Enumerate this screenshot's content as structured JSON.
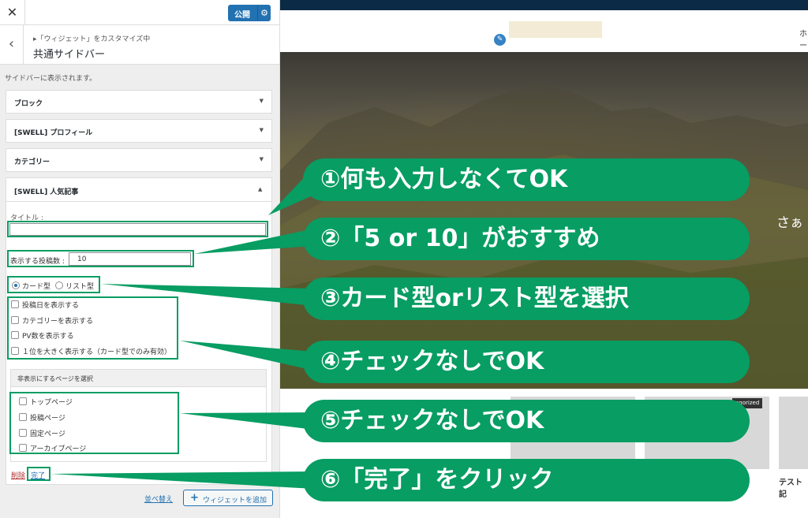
{
  "topbar": {
    "close": "✕",
    "publish_label": "公開",
    "gear_icon": "⚙"
  },
  "section": {
    "back": "‹",
    "breadcrumb": "▸「ウィジェット」をカスタマイズ中",
    "title": "共通サイドバー",
    "description": "サイドバーに表示されます。"
  },
  "widgets": [
    {
      "title": "ブロック",
      "arrow": "▼"
    },
    {
      "title": "[SWELL] プロフィール",
      "arrow": "▼"
    },
    {
      "title": "カテゴリー",
      "arrow": "▼"
    }
  ],
  "open_widget": {
    "title": "[SWELL] 人気記事",
    "arrow": "▲",
    "title_label": "タイトル :",
    "title_value": "",
    "count_label": "表示する投稿数 :",
    "count_value": "10",
    "radio_card": "カード型",
    "radio_list": "リスト型",
    "checkboxes": [
      "投稿日を表示する",
      "カテゴリーを表示する",
      "PV数を表示する",
      "１位を大きく表示する（カード型でのみ有効）"
    ],
    "hide_header": "非表示にするページを選択",
    "hide_pages": [
      "トップページ",
      "投稿ページ",
      "固定ページ",
      "アーカイブページ"
    ],
    "delete": "削除",
    "separator": "|",
    "done": "完了"
  },
  "footer": {
    "reorder": "並べ替え",
    "add_widget": "ウィジェットを追加",
    "add_icon": "+"
  },
  "preview": {
    "nav": "ホー",
    "edit_icon": "✎",
    "hero_text": "さぁ",
    "badge": "egorized",
    "card_title": "テスト記"
  },
  "callouts": [
    "①何も入力しなくてOK",
    "②「5 or 10」がおすすめ",
    "③カード型orリスト型を選択",
    "④チェックなしでOK",
    "⑤チェックなしでOK",
    "⑥「完了」をクリック"
  ],
  "colors": {
    "accent_green": "#079d63",
    "wp_blue": "#2271b1",
    "preview_header": "#0b2a45"
  }
}
